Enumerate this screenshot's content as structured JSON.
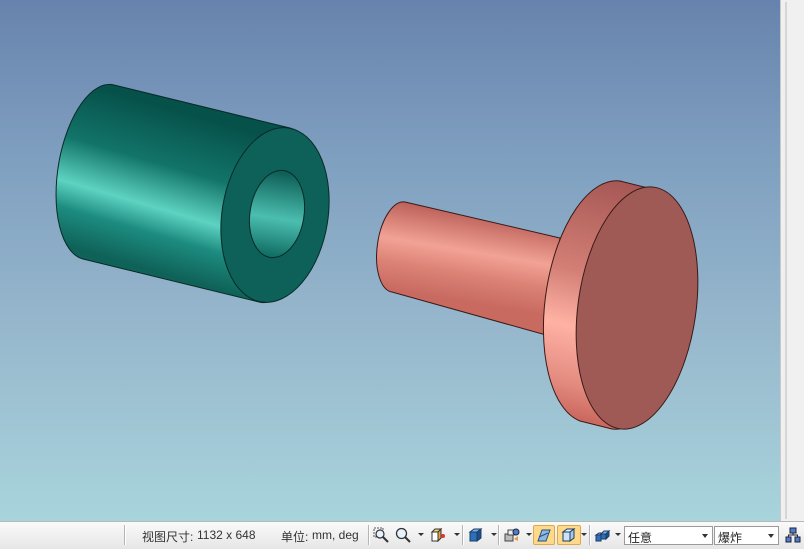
{
  "status": {
    "view_size_label": "视图尺寸:",
    "view_size_value": "1132 x 648",
    "units_label": "单位:",
    "units_value": "mm, deg"
  },
  "combos": {
    "orientation": "任意",
    "mode": "爆炸"
  },
  "icons": [
    "zoom-fit-icon",
    "zoom-icon",
    "view-cube-icon",
    "shaded-box-icon",
    "render-mode-icon",
    "section-plane-icon",
    "wireframe-box-icon",
    "display-style-icon",
    "assembly-tree-icon"
  ],
  "colors": {
    "sleeve": "#16756a",
    "pin": "#d57b70",
    "background_top": "#6783ad",
    "background_bottom": "#a8d4dc"
  }
}
